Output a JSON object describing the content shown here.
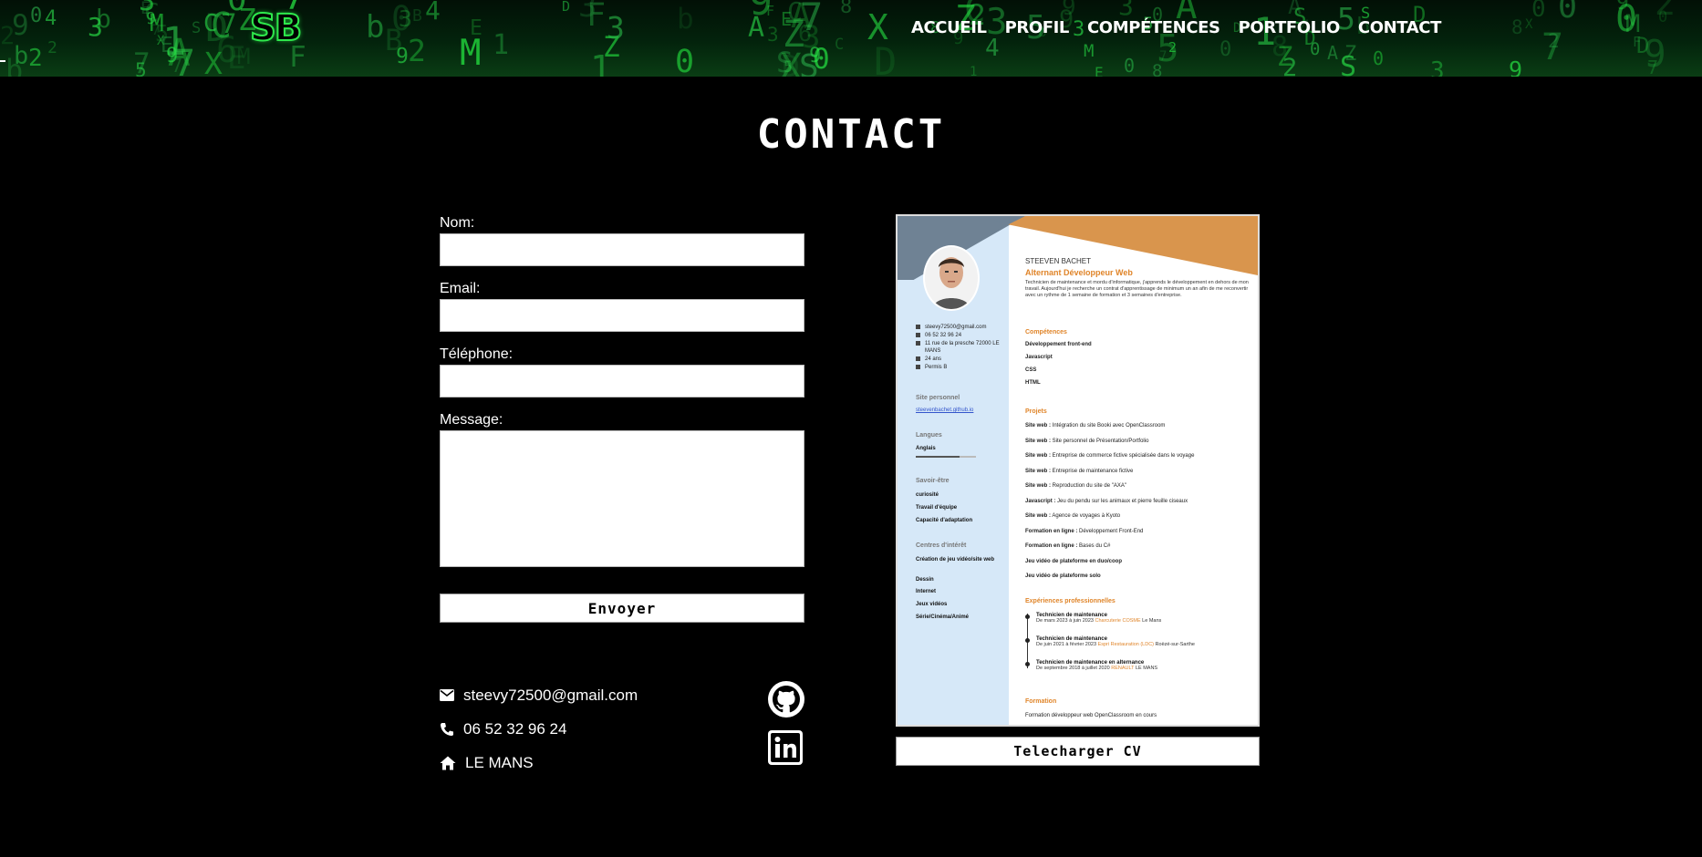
{
  "header": {
    "logo": "SB",
    "nav": [
      "ACCUEIL",
      "PROFIL",
      "COMPÉTENCES",
      "PORTFOLIO",
      "CONTACT"
    ]
  },
  "page_title": "CONTACT",
  "form": {
    "name_label": "Nom:",
    "email_label": "Email:",
    "phone_label": "Téléphone:",
    "message_label": "Message:",
    "name_value": "",
    "email_value": "",
    "phone_value": "",
    "message_value": "",
    "submit_label": "Envoyer"
  },
  "contact_info": {
    "email": "steevy72500@gmail.com",
    "phone": "06 52 32 96 24",
    "city": "LE MANS"
  },
  "social": [
    "github-icon",
    "linkedin-icon"
  ],
  "cv": {
    "name": "STEEVEN BACHET",
    "role": "Alternant Développeur Web",
    "description": "Technicien de maintenance et mordu d'informatique, j'apprends le développement en dehors de mon travail. Aujourd'hui je recherche un contrat d'apprentissage de minimum un an afin de me reconvertir avec un rythme de 1 semaine de formation et 3 semaines d'entreprise.",
    "side_contact": [
      "steevy72500@gmail.com",
      "06 52 32 96 24",
      "11 rue de la presche 72000 LE MANS",
      "24 ans",
      "Permis B"
    ],
    "site_title": "Site personnel",
    "site_link": "steevenbachet.github.io",
    "languages_title": "Langues",
    "language": "Anglais",
    "savoir_title": "Savoir-être",
    "savoir": [
      "curiosité",
      "Travail d'équipe",
      "Capacité d'adaptation"
    ],
    "interests_title": "Centres d'intérêt",
    "interests": [
      "Création de jeu vidéo/site web",
      "Dessin",
      "Internet",
      "Jeux vidéos",
      "Série/Cinéma/Animé"
    ],
    "skills_title": "Compétences",
    "skills": [
      "Développement front-end",
      "Javascript",
      "CSS",
      "HTML"
    ],
    "projects_title": "Projets",
    "projects": [
      {
        "k": "Site web :",
        "v": "Intégration du site Booki avec OpenClassroom"
      },
      {
        "k": "Site web :",
        "v": "Site personnel de Présentation/Portfolio"
      },
      {
        "k": "Site web :",
        "v": "Entreprise de commerce fictive spécialisée dans le voyage"
      },
      {
        "k": "Site web :",
        "v": "Entreprise de maintenance fictive"
      },
      {
        "k": "Site web :",
        "v": "Reproduction du site de \"AXA\""
      },
      {
        "k": "Javascript :",
        "v": "Jeu du pendu sur les animaux et pierre feuille ciseaux"
      },
      {
        "k": "Site web :",
        "v": "Agence de voyages à Kyoto"
      },
      {
        "k": "Formation en ligne :",
        "v": "Développement Front-End"
      },
      {
        "k": "Formation en ligne :",
        "v": "Bases du C#"
      },
      {
        "k": "Jeu vidéo de plateforme en duo/coop",
        "v": ""
      },
      {
        "k": "Jeu vidéo de plateforme solo",
        "v": ""
      }
    ],
    "experience_title": "Expériences professionnelles",
    "experiences": [
      {
        "title": "Technicien de maintenance",
        "dates": "De mars 2023 à juin 2023",
        "company": "Charcuterie COSME",
        "place": "Le Mans"
      },
      {
        "title": "Technicien de maintenance",
        "dates": "De juin 2021 à février 2023",
        "company": "Espri Restauration (LDC)",
        "place": "Roëzé-sur-Sarthe"
      },
      {
        "title": "Technicien de maintenance en alternance",
        "dates": "De septembre 2018 à juillet 2020",
        "company": "RENAULT",
        "place": "LE MANS"
      }
    ],
    "formation_title": "Formation",
    "formation": "Formation développeur web OpenClassroom en cours",
    "download_label": "Telecharger CV"
  },
  "colors": {
    "accent_green": "#2ee84c",
    "cv_orange": "#e0852a",
    "cv_side": "#d6e8f8"
  }
}
